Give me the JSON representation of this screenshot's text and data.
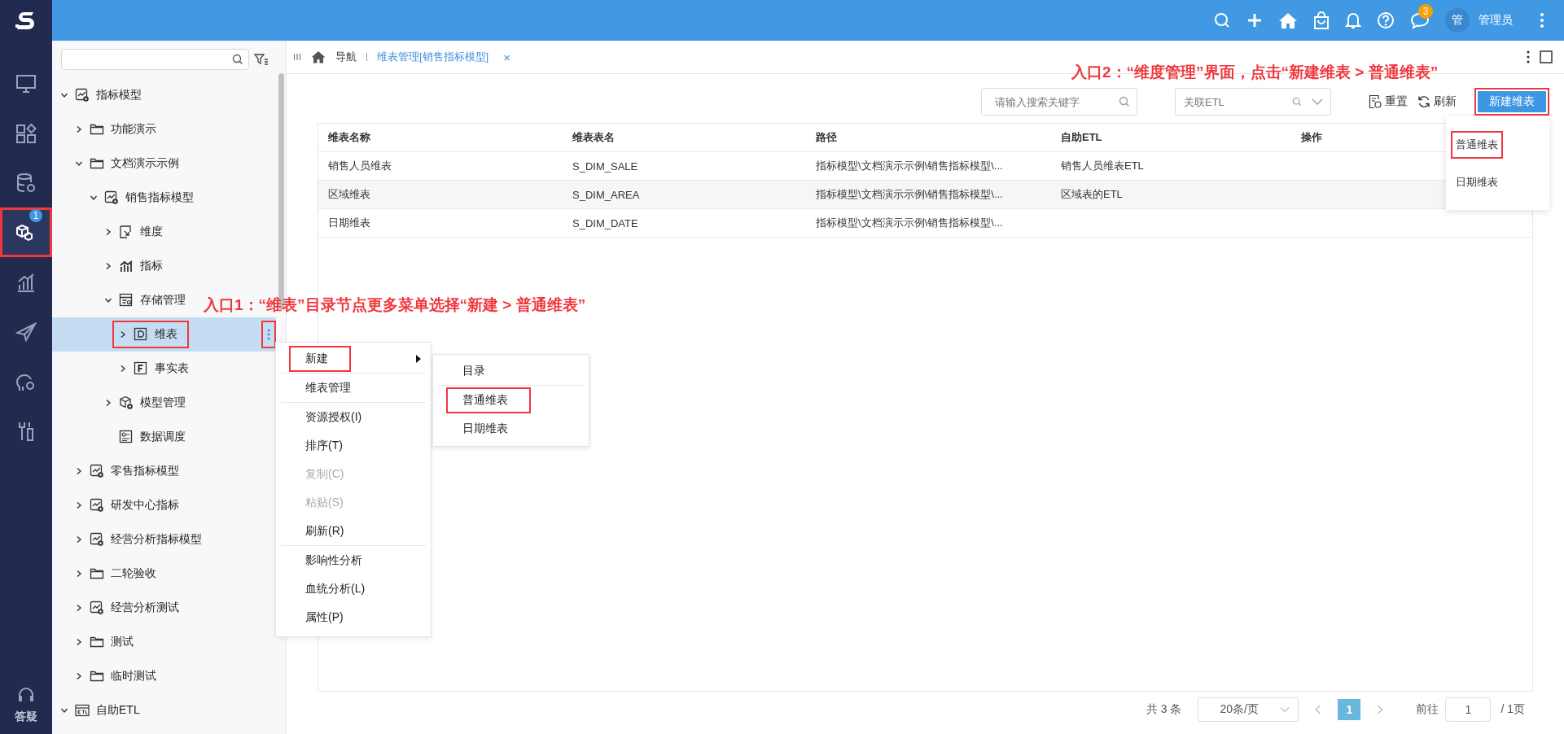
{
  "top_bar": {
    "message_badge": "3",
    "avatar": "管",
    "user_name": "管理员"
  },
  "nav": {
    "items": [
      {
        "selected": false,
        "highlighted": false
      },
      {
        "selected": false,
        "highlighted": false
      },
      {
        "selected": false,
        "highlighted": false
      },
      {
        "selected": true,
        "highlighted": true,
        "badge": "1"
      },
      {
        "selected": false,
        "highlighted": false
      },
      {
        "selected": false,
        "highlighted": false
      },
      {
        "selected": false,
        "highlighted": false
      },
      {
        "selected": false,
        "highlighted": false
      }
    ],
    "help_label": "答疑"
  },
  "tree": {
    "items": [
      {
        "label": "指标模型",
        "kind": "model",
        "expanded": true,
        "selected": false,
        "highlighted": false,
        "children": [
          {
            "label": "功能演示",
            "kind": "folder",
            "expanded": false,
            "selected": false,
            "highlighted": false
          },
          {
            "label": "文档演示示例",
            "kind": "folder",
            "expanded": true,
            "selected": false,
            "highlighted": false,
            "children": [
              {
                "label": "销售指标模型",
                "kind": "model",
                "expanded": true,
                "selected": false,
                "highlighted": false,
                "children": [
                  {
                    "label": "维度",
                    "kind": "dimension",
                    "expanded": false,
                    "selected": false,
                    "highlighted": false
                  },
                  {
                    "label": "指标",
                    "kind": "metric",
                    "expanded": false,
                    "selected": false,
                    "highlighted": false
                  },
                  {
                    "label": "存储管理",
                    "kind": "storage",
                    "expanded": true,
                    "selected": false,
                    "highlighted": false,
                    "children": [
                      {
                        "label": "维表",
                        "kind": "dim-table",
                        "expanded": false,
                        "selected": true,
                        "highlighted": true,
                        "more_highlighted": true
                      },
                      {
                        "label": "事实表",
                        "kind": "fact-table",
                        "expanded": false,
                        "selected": false,
                        "highlighted": false
                      }
                    ]
                  },
                  {
                    "label": "模型管理",
                    "kind": "cube",
                    "expanded": false,
                    "selected": false,
                    "highlighted": false
                  },
                  {
                    "label": "数据调度",
                    "kind": "schedule",
                    "selected": false,
                    "highlighted": false
                  }
                ]
              }
            ]
          },
          {
            "label": "零售指标模型",
            "kind": "model",
            "expanded": false,
            "selected": false,
            "highlighted": false
          },
          {
            "label": "研发中心指标",
            "kind": "model",
            "expanded": false,
            "selected": false,
            "highlighted": false
          },
          {
            "label": "经营分析指标模型",
            "kind": "model",
            "expanded": false,
            "selected": false,
            "highlighted": false
          },
          {
            "label": "二轮验收",
            "kind": "folder",
            "expanded": false,
            "selected": false,
            "highlighted": false
          },
          {
            "label": "经营分析测试",
            "kind": "model",
            "expanded": false,
            "selected": false,
            "highlighted": false
          },
          {
            "label": "测试",
            "kind": "folder",
            "expanded": false,
            "selected": false,
            "highlighted": false
          },
          {
            "label": "临时测试",
            "kind": "folder",
            "expanded": false,
            "selected": false,
            "highlighted": false
          }
        ]
      },
      {
        "label": "自助ETL",
        "kind": "etl",
        "expanded": true,
        "selected": false,
        "highlighted": false
      }
    ]
  },
  "context_menu": {
    "sections": [
      [
        {
          "label": "新建",
          "disabled": false,
          "highlighted": true,
          "has_submenu": true
        }
      ],
      [
        {
          "label": "维表管理",
          "disabled": false,
          "highlighted": false,
          "has_submenu": false
        }
      ],
      [
        {
          "label": "资源授权(I)",
          "disabled": false,
          "highlighted": false,
          "has_submenu": false
        },
        {
          "label": "排序(T)",
          "disabled": false,
          "highlighted": false,
          "has_submenu": false
        },
        {
          "label": "复制(C)",
          "disabled": true,
          "highlighted": false,
          "has_submenu": false
        },
        {
          "label": "粘贴(S)",
          "disabled": true,
          "highlighted": false,
          "has_submenu": false
        },
        {
          "label": "刷新(R)",
          "disabled": false,
          "highlighted": false,
          "has_submenu": false
        }
      ],
      [
        {
          "label": "影响性分析",
          "disabled": false,
          "highlighted": false,
          "has_submenu": false
        },
        {
          "label": "血统分析(L)",
          "disabled": false,
          "highlighted": false,
          "has_submenu": false
        },
        {
          "label": "属性(P)",
          "disabled": false,
          "highlighted": false,
          "has_submenu": false
        }
      ]
    ],
    "submenu": {
      "sections": [
        [
          {
            "label": "目录",
            "highlighted": false
          }
        ],
        [
          {
            "label": "普通维表",
            "highlighted": true
          },
          {
            "label": "日期维表",
            "highlighted": false
          }
        ]
      ]
    }
  },
  "callouts": [
    {
      "text": "入口1：“维表”目录节点更多菜单选择“新建 > 普通维表”"
    },
    {
      "text": "入口2：“维度管理”界面，点击“新建维表 > 普通维表”"
    }
  ],
  "tab_bar": {
    "nav_label": "导航",
    "tabs": [
      {
        "label": "维表管理[销售指标模型]",
        "selected": true,
        "close": "×"
      }
    ]
  },
  "toolbar": {
    "search_placeholder": "请输入搜索关键字",
    "etl_placeholder": "关联ETL",
    "reset": "重置",
    "refresh": "刷新",
    "new_button": {
      "label": "新建维表",
      "highlighted": true
    }
  },
  "new_dropdown": {
    "items": [
      {
        "label": "普通维表",
        "highlighted": true
      },
      {
        "label": "日期维表",
        "highlighted": false
      }
    ]
  },
  "table": {
    "columns": [
      "维表名称",
      "维表表名",
      "路径",
      "自助ETL",
      "操作"
    ],
    "rows": [
      [
        "销售人员维表",
        "S_DIM_SALE",
        "指标模型\\文档演示示例\\销售指标模型\\...",
        "销售人员维表ETL",
        ""
      ],
      [
        "区域维表",
        "S_DIM_AREA",
        "指标模型\\文档演示示例\\销售指标模型\\...",
        "区域表的ETL",
        ""
      ],
      [
        "日期维表",
        "S_DIM_DATE",
        "指标模型\\文档演示示例\\销售指标模型\\...",
        "",
        ""
      ]
    ]
  },
  "pagination": {
    "total": "共 3 条",
    "page_size": "20条/页",
    "pages": [
      {
        "label": "1",
        "selected": true
      }
    ],
    "goto_label": "前往",
    "goto_value": "1",
    "page_count": "/ 1页"
  }
}
